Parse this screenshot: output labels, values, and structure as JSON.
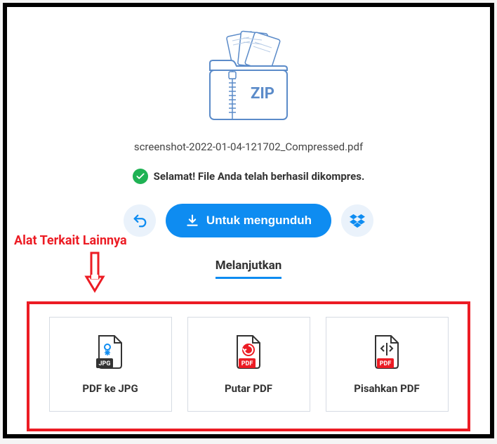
{
  "filename": "screenshot-2022-01-04-121702_Compressed.pdf",
  "success_message": "Selamat! File Anda telah berhasil dikompres.",
  "download_button_label": "Untuk mengunduh",
  "continue_label": "Melanjutkan",
  "annotation_label": "Alat Terkait Lainnya",
  "zip_label": "ZIP",
  "tools": {
    "tool1": {
      "label": "PDF ke JPG",
      "badge": "JPG"
    },
    "tool2": {
      "label": "Putar PDF",
      "badge": "PDF"
    },
    "tool3": {
      "label": "Pisahkan PDF",
      "badge": "PDF"
    }
  }
}
